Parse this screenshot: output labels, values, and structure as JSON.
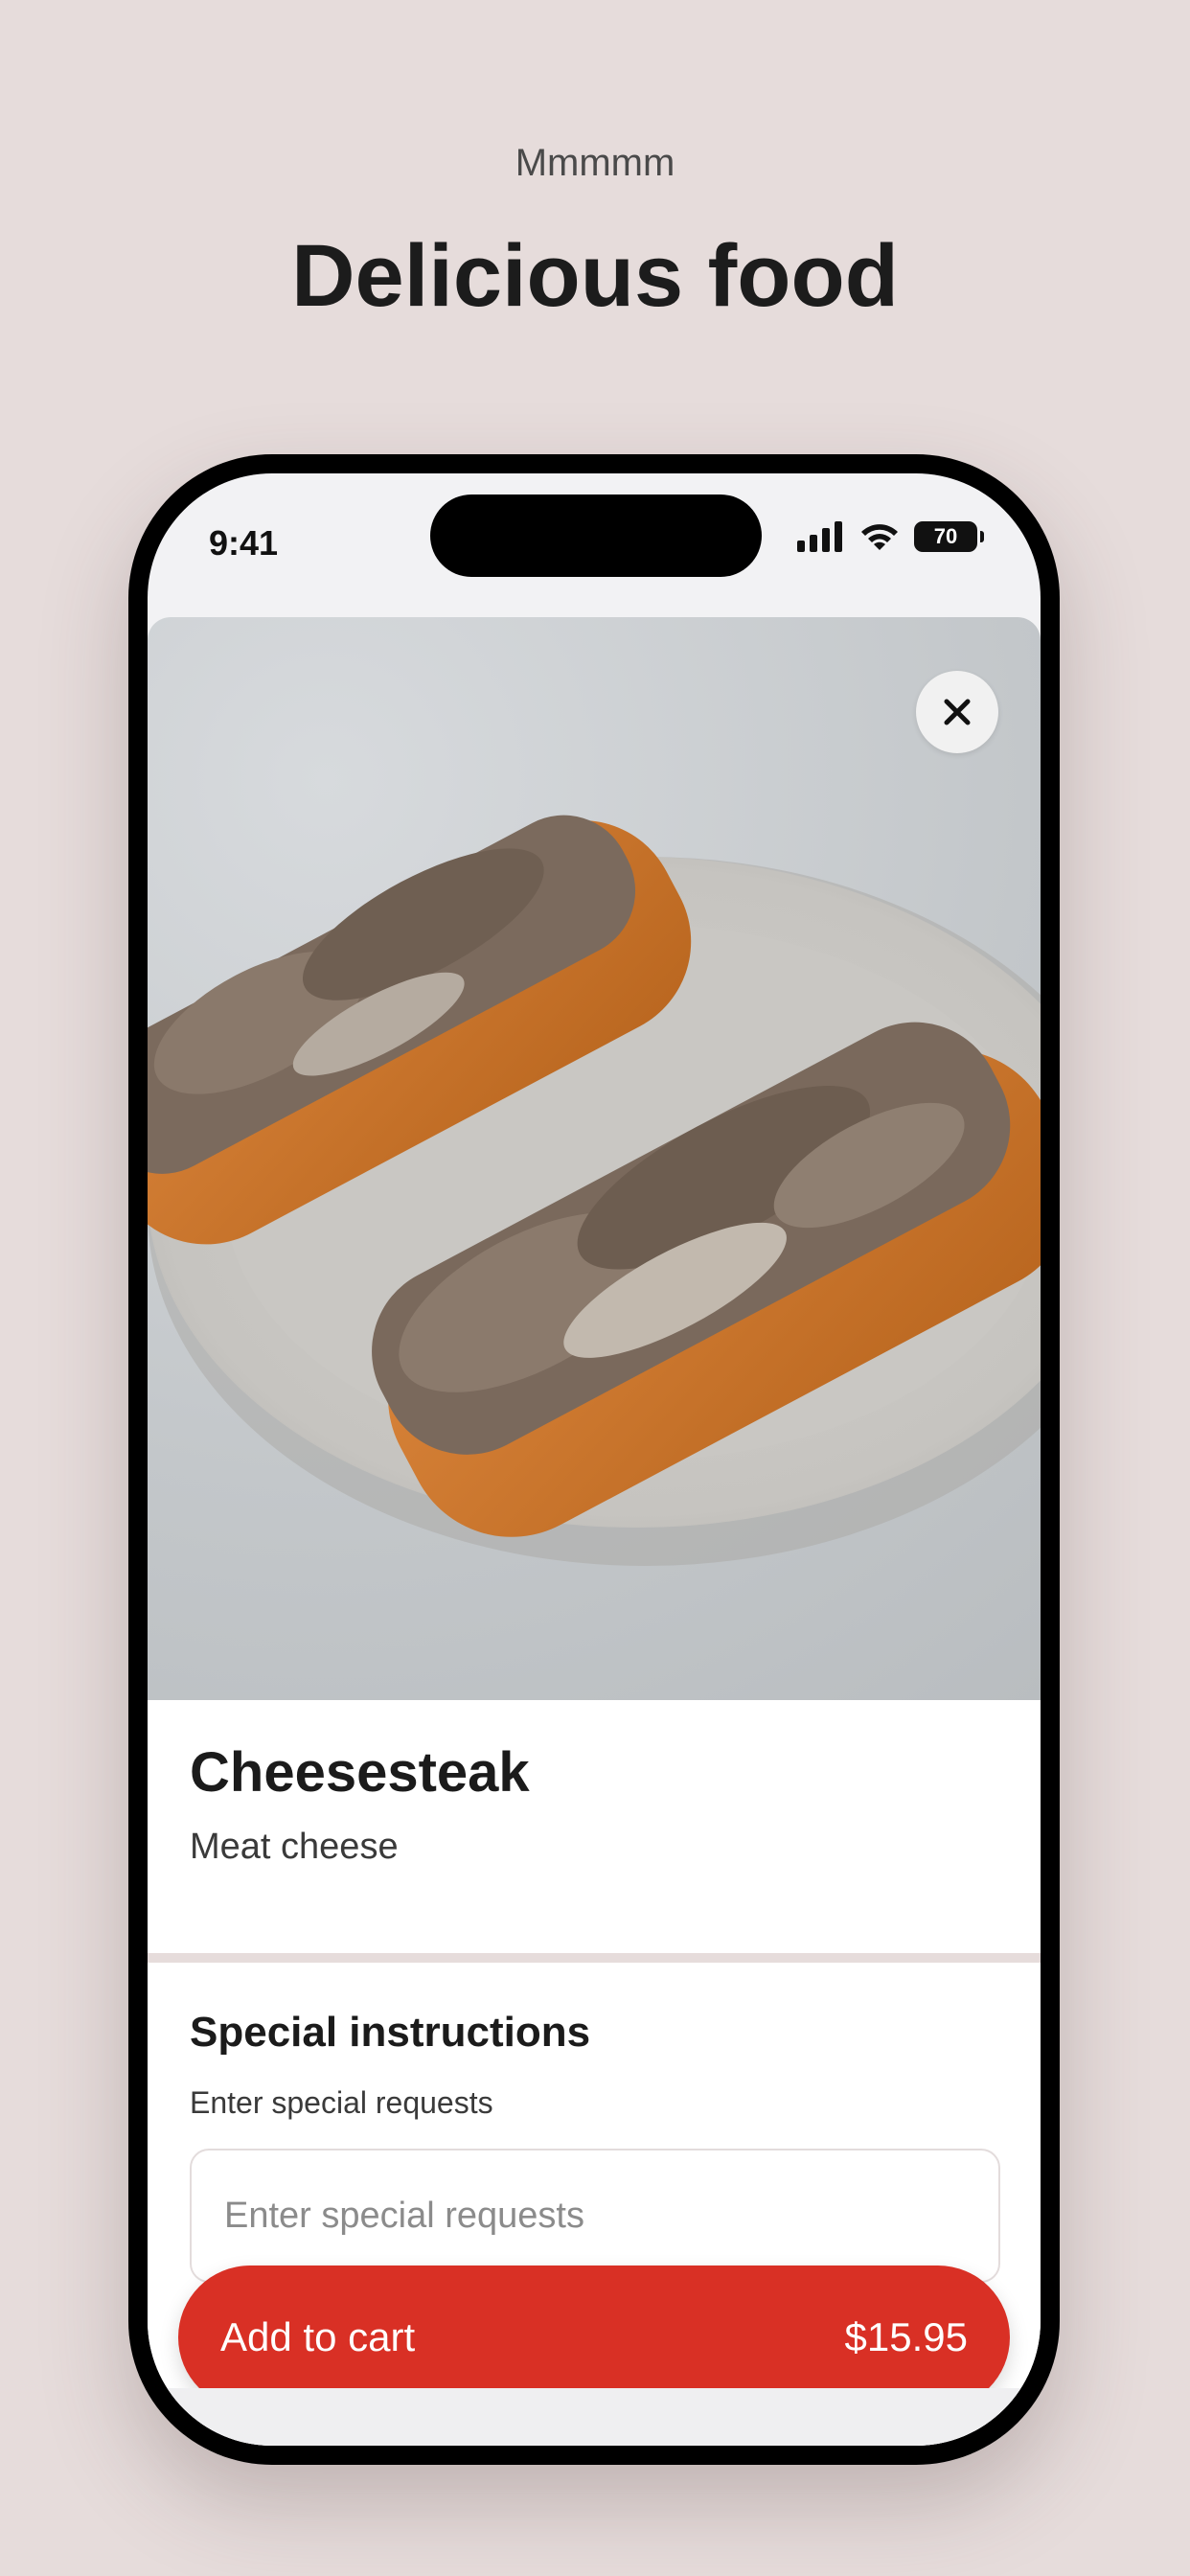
{
  "page": {
    "eyebrow": "Mmmmm",
    "headline": "Delicious food",
    "background_color": "#e6dcdb"
  },
  "status_bar": {
    "time": "9:41",
    "battery": "70"
  },
  "item": {
    "image_alt": "cheesesteak-sandwich-photo",
    "name": "Cheesesteak",
    "description": "Meat cheese"
  },
  "special_instructions": {
    "title": "Special instructions",
    "subtitle": "Enter special requests",
    "placeholder": "Enter special requests"
  },
  "cart_button": {
    "label": "Add to cart",
    "price": "$15.95",
    "color": "#d93025"
  },
  "icons": {
    "close": "close-icon",
    "signal": "cellular-signal-icon",
    "wifi": "wifi-icon",
    "battery": "battery-icon"
  }
}
